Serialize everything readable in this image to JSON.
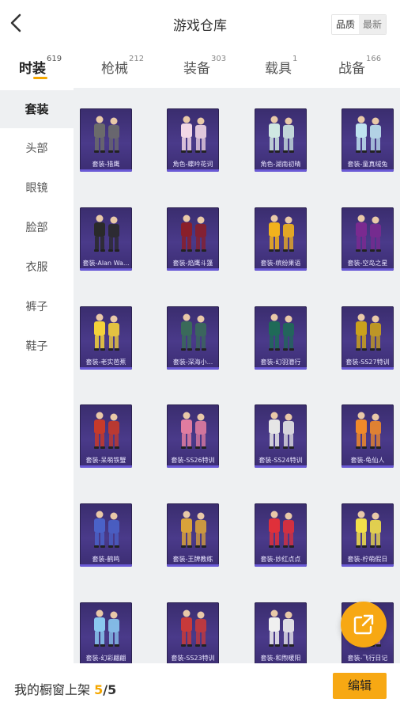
{
  "header": {
    "title": "游戏仓库",
    "sort_quality": "品质",
    "sort_newest": "最新"
  },
  "tabs": [
    {
      "label": "时装",
      "count": "619"
    },
    {
      "label": "枪械",
      "count": "212"
    },
    {
      "label": "装备",
      "count": "303"
    },
    {
      "label": "载具",
      "count": "1"
    },
    {
      "label": "战备",
      "count": "166"
    }
  ],
  "sidebar": {
    "items": [
      {
        "label": "套装"
      },
      {
        "label": "头部"
      },
      {
        "label": "眼镜"
      },
      {
        "label": "脸部"
      },
      {
        "label": "衣服"
      },
      {
        "label": "裤子"
      },
      {
        "label": "鞋子"
      }
    ]
  },
  "grid": {
    "items": [
      {
        "label": "套装-猎鹰",
        "accent": "#6b6b6b"
      },
      {
        "label": "角色-蝶吟花词",
        "accent": "#f2d7e6"
      },
      {
        "label": "角色-湖南初晴",
        "accent": "#cfe8e2"
      },
      {
        "label": "套装-童真绒兔",
        "accent": "#bfe3f0"
      },
      {
        "label": "套装-Alan Wa...",
        "accent": "#2a2a2a"
      },
      {
        "label": "套装-焰鹰斗篷",
        "accent": "#8a1f2a"
      },
      {
        "label": "套装-缤纷果语",
        "accent": "#f2b21c"
      },
      {
        "label": "套装-空岛之星",
        "accent": "#7a2a90"
      },
      {
        "label": "套装-老实芭蕉",
        "accent": "#f4d23a"
      },
      {
        "label": "套装-深海小...",
        "accent": "#3a6a5a"
      },
      {
        "label": "套装-幻羽潜行",
        "accent": "#1f6a58"
      },
      {
        "label": "套装-SS27特训",
        "accent": "#caa11c"
      },
      {
        "label": "套装-呆萌铁蟹",
        "accent": "#c73a2a"
      },
      {
        "label": "套装-SS26特训",
        "accent": "#e07ca0"
      },
      {
        "label": "套装-SS24特训",
        "accent": "#e6e6e6"
      },
      {
        "label": "套装-龟仙人",
        "accent": "#f08a2a"
      },
      {
        "label": "套装-鹤鸣",
        "accent": "#4a62c8"
      },
      {
        "label": "套装-王牌教练",
        "accent": "#d9a23a"
      },
      {
        "label": "套装-妙红点点",
        "accent": "#e0303a"
      },
      {
        "label": "套装-柠萌假日",
        "accent": "#f2e04a"
      },
      {
        "label": "套装-幻彩翩翩",
        "accent": "#8ac8f0"
      },
      {
        "label": "套装-SS23特训",
        "accent": "#c83a3a"
      },
      {
        "label": "套装-和煦暖阳",
        "accent": "#f0f0f0"
      },
      {
        "label": "套装-飞行日记",
        "accent": "#e8a0b8"
      }
    ]
  },
  "footer": {
    "label": "我的橱窗上架",
    "current": "5",
    "separator": "/",
    "total": "5",
    "edit_label": "编辑"
  },
  "colors": {
    "accent": "#f7a813",
    "card_bg": "#3f3180",
    "content_bg": "#eef0f2"
  },
  "icons": {
    "back": "chevron-left-icon",
    "share": "external-link-icon"
  }
}
